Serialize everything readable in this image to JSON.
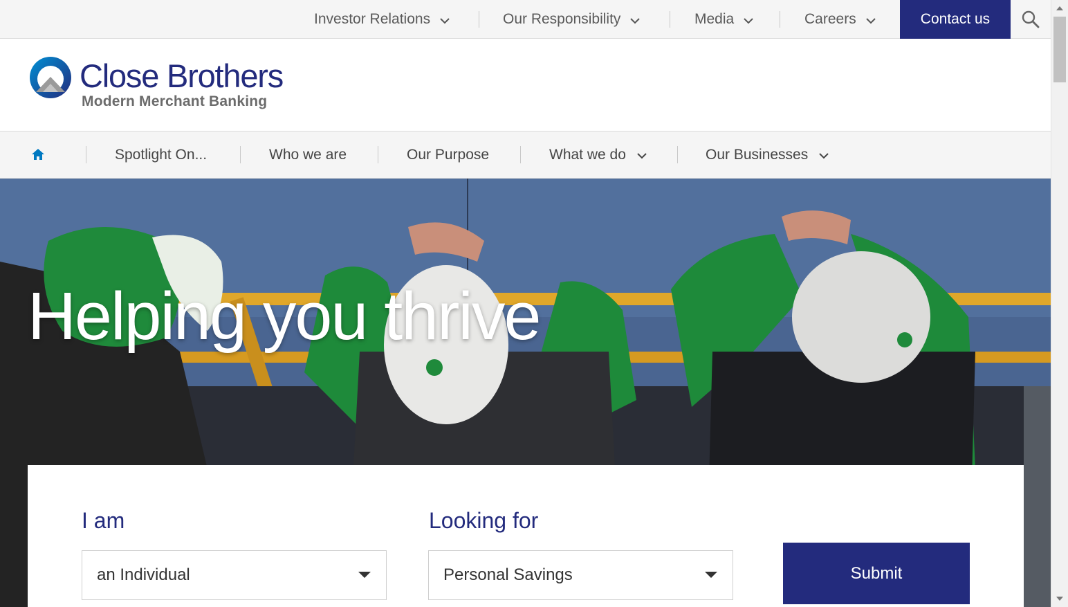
{
  "colors": {
    "brand_navy": "#232b7d",
    "brand_blue": "#0079c1",
    "nav_bg": "#f5f5f5",
    "text_grey": "#5a5a5a"
  },
  "utility_nav": {
    "items": [
      {
        "label": "Investor Relations",
        "icon": "chevron-down-icon"
      },
      {
        "label": "Our Responsibility",
        "icon": "chevron-down-icon"
      },
      {
        "label": "Media",
        "icon": "chevron-down-icon"
      },
      {
        "label": "Careers",
        "icon": "chevron-down-icon"
      }
    ],
    "contact_label": "Contact us",
    "search_icon": "search-icon"
  },
  "logo": {
    "name": "Close Brothers",
    "tagline": "Modern Merchant Banking"
  },
  "main_nav": {
    "home_icon": "home-icon",
    "items": [
      {
        "label": "Spotlight On..."
      },
      {
        "label": "Who we are"
      },
      {
        "label": "Our Purpose"
      },
      {
        "label": "What we do",
        "icon": "chevron-down-icon"
      },
      {
        "label": "Our Businesses",
        "icon": "chevron-down-icon"
      }
    ]
  },
  "hero": {
    "title": "Helping you thrive",
    "image_subject": "workers in green jackets and white hard hats leaning on a yellow railing"
  },
  "finder": {
    "i_am_label": "I am",
    "i_am_value": "an Individual",
    "looking_for_label": "Looking for",
    "looking_for_value": "Personal Savings",
    "submit_label": "Submit"
  }
}
